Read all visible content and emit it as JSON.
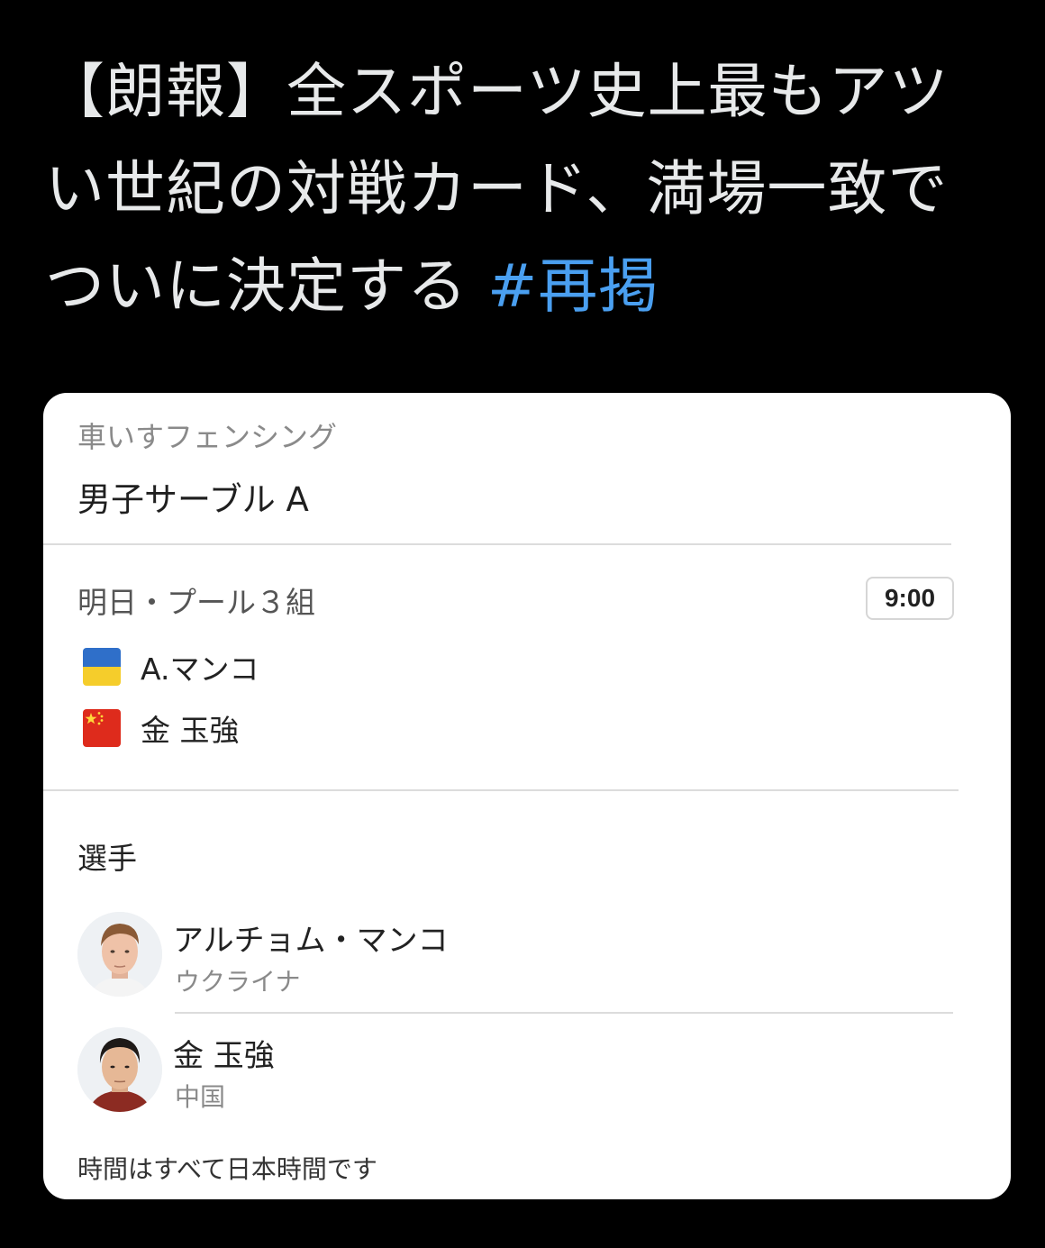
{
  "tweet": {
    "text": "【朗報】全スポーツ史上最もアツい世紀の対戦カード、満場一致でついに決定する ",
    "hashtag": "#再掲",
    "hashtag_color": "#4a9ff0"
  },
  "card": {
    "sport": "車いすフェンシング",
    "event": "男子サーブル A",
    "match": {
      "info": "明日・プール３組",
      "time": "9:00",
      "teams": [
        {
          "name": "A.マンコ",
          "flag_icon": "ukraine-flag-icon"
        },
        {
          "name": "金 玉強",
          "flag_icon": "china-flag-icon"
        }
      ]
    },
    "players_section": {
      "title": "選手",
      "players": [
        {
          "name": "アルチョム・マンコ",
          "country": "ウクライナ"
        },
        {
          "name": "金 玉強",
          "country": "中国"
        }
      ]
    },
    "footnote": "時間はすべて日本時間です"
  }
}
